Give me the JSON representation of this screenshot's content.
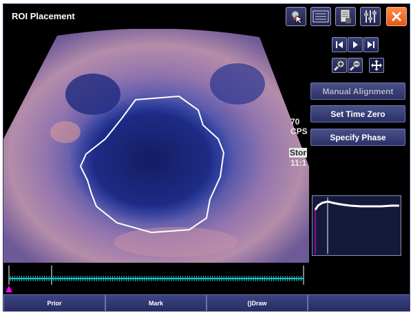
{
  "window": {
    "title": "ROI Placement"
  },
  "toolbar": {
    "icons": [
      "roi-tool-icon",
      "monitor-display-icon",
      "report-document-icon",
      "settings-tools-icon",
      "close-icon"
    ]
  },
  "image_overlay": {
    "line1": "70",
    "line2": "CPS",
    "line3": "Stor",
    "line4": "11:1"
  },
  "side_panel": {
    "playback": [
      "skip-back-icon",
      "play-icon",
      "skip-forward-icon"
    ],
    "zoom": [
      "zoom-in-icon",
      "zoom-out-icon",
      "pan-move-icon"
    ],
    "manual_alignment_label": "Manual Alignment",
    "set_time_zero_label": "Set Time Zero",
    "specify_phase_label": "Specify Phase"
  },
  "bottom_bar": {
    "prior_label": "Prior",
    "mark_label": "Mark",
    "draw_label": "()Draw",
    "empty_label": ""
  },
  "colors": {
    "accent": "#2b3066",
    "timeline": "#1ec8c8",
    "marker": "#ff00ff",
    "close": "#e2571a"
  }
}
